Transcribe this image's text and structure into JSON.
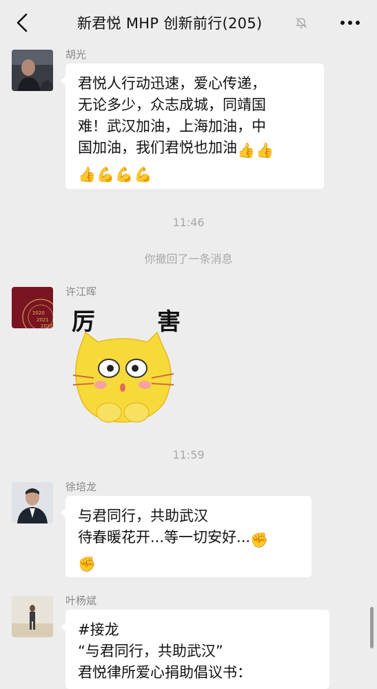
{
  "header": {
    "title": "新君悦 MHP 创新前行(205)",
    "back_icon": "back-arrow-icon",
    "mute_icon": "mute-bell-icon",
    "more_icon": "more-dots-icon"
  },
  "messages": [
    {
      "sender": "胡光",
      "lines": [
        "君悦人行动迅速，爱心传递，",
        "无论多少，众志成城，同靖国",
        "难！武汉加油，上海加油，中",
        "国加油，我们君悦也加油"
      ],
      "trailing_emojis": [
        "👍",
        "👍"
      ],
      "emoji_line": [
        "👍",
        "💪",
        "💪",
        "💪"
      ]
    },
    {
      "sender": "许江晖",
      "sticker_text_left": "厉",
      "sticker_text_right": "害",
      "avatar_labels": [
        "2020",
        "2021",
        "2022"
      ]
    },
    {
      "sender": "徐培龙",
      "lines": [
        "与君同行，共助武汉",
        "待春暖花开...等一切安好..."
      ],
      "trailing_emojis": [
        "✊"
      ],
      "emoji_line": [
        "✊"
      ]
    },
    {
      "sender": "叶杨斌",
      "lines": [
        "#接龙",
        "“与君同行，共助武汉”",
        "君悦律所爱心捐助倡议书："
      ]
    }
  ],
  "system": {
    "time1": "11:46",
    "recall_notice": "你撤回了一条消息",
    "time2": "11:59"
  }
}
